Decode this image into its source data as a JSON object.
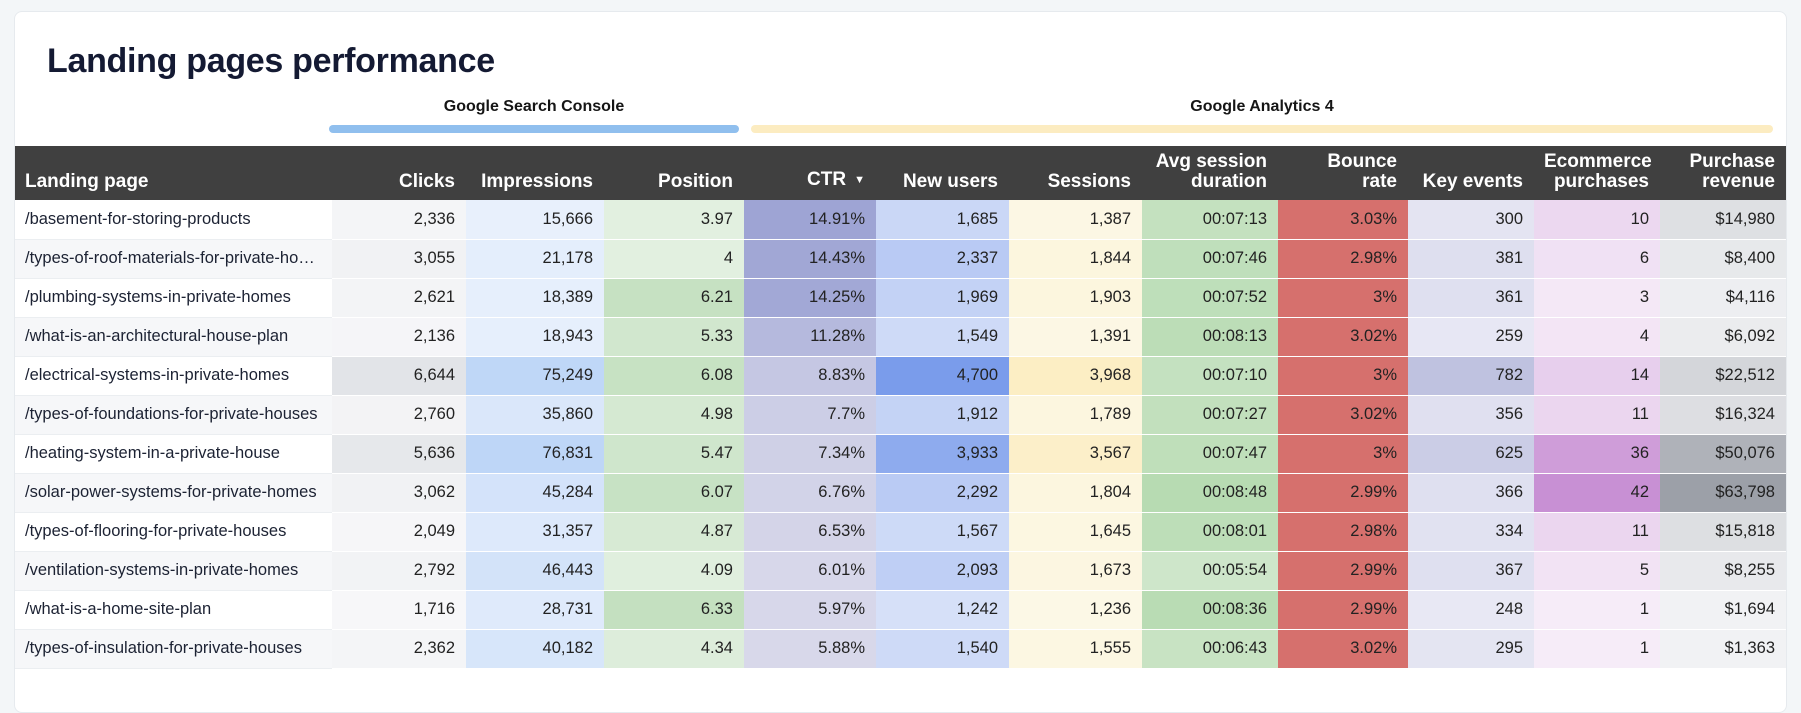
{
  "title": "Landing pages performance",
  "groups": {
    "search_console": "Google Search Console",
    "analytics": "Google Analytics 4"
  },
  "colors": {
    "search_console_bar": "#90bfee",
    "analytics_bar": "#fcecc1",
    "header_bg": "#404040"
  },
  "columns": [
    {
      "key": "page",
      "label": "Landing page"
    },
    {
      "key": "clicks",
      "label": "Clicks"
    },
    {
      "key": "impressions",
      "label": "Impressions"
    },
    {
      "key": "position",
      "label": "Position"
    },
    {
      "key": "ctr",
      "label": "CTR",
      "sorted": "desc"
    },
    {
      "key": "new_users",
      "label": "New users"
    },
    {
      "key": "sessions",
      "label": "Sessions"
    },
    {
      "key": "avg_session_duration",
      "label": "Avg session duration"
    },
    {
      "key": "bounce_rate",
      "label": "Bounce rate"
    },
    {
      "key": "key_events",
      "label": "Key events"
    },
    {
      "key": "ecommerce_purchases",
      "label": "Ecommerce purchases"
    },
    {
      "key": "purchase_revenue",
      "label": "Purchase revenue"
    }
  ],
  "rows": [
    {
      "page": "/basement-for-storing-products",
      "clicks": "2,336",
      "impressions": "15,666",
      "position": "3.97",
      "ctr": "14.91%",
      "new_users": "1,685",
      "sessions": "1,387",
      "avg_session_duration": "00:07:13",
      "bounce_rate": "3.03%",
      "key_events": "300",
      "ecommerce_purchases": "10",
      "purchase_revenue": "$14,980"
    },
    {
      "page": "/types-of-roof-materials-for-private-hou…",
      "clicks": "3,055",
      "impressions": "21,178",
      "position": "4",
      "ctr": "14.43%",
      "new_users": "2,337",
      "sessions": "1,844",
      "avg_session_duration": "00:07:46",
      "bounce_rate": "2.98%",
      "key_events": "381",
      "ecommerce_purchases": "6",
      "purchase_revenue": "$8,400"
    },
    {
      "page": "/plumbing-systems-in-private-homes",
      "clicks": "2,621",
      "impressions": "18,389",
      "position": "6.21",
      "ctr": "14.25%",
      "new_users": "1,969",
      "sessions": "1,903",
      "avg_session_duration": "00:07:52",
      "bounce_rate": "3%",
      "key_events": "361",
      "ecommerce_purchases": "3",
      "purchase_revenue": "$4,116"
    },
    {
      "page": "/what-is-an-architectural-house-plan",
      "clicks": "2,136",
      "impressions": "18,943",
      "position": "5.33",
      "ctr": "11.28%",
      "new_users": "1,549",
      "sessions": "1,391",
      "avg_session_duration": "00:08:13",
      "bounce_rate": "3.02%",
      "key_events": "259",
      "ecommerce_purchases": "4",
      "purchase_revenue": "$6,092"
    },
    {
      "page": "/electrical-systems-in-private-homes",
      "clicks": "6,644",
      "impressions": "75,249",
      "position": "6.08",
      "ctr": "8.83%",
      "new_users": "4,700",
      "sessions": "3,968",
      "avg_session_duration": "00:07:10",
      "bounce_rate": "3%",
      "key_events": "782",
      "ecommerce_purchases": "14",
      "purchase_revenue": "$22,512"
    },
    {
      "page": "/types-of-foundations-for-private-houses",
      "clicks": "2,760",
      "impressions": "35,860",
      "position": "4.98",
      "ctr": "7.7%",
      "new_users": "1,912",
      "sessions": "1,789",
      "avg_session_duration": "00:07:27",
      "bounce_rate": "3.02%",
      "key_events": "356",
      "ecommerce_purchases": "11",
      "purchase_revenue": "$16,324"
    },
    {
      "page": "/heating-system-in-a-private-house",
      "clicks": "5,636",
      "impressions": "76,831",
      "position": "5.47",
      "ctr": "7.34%",
      "new_users": "3,933",
      "sessions": "3,567",
      "avg_session_duration": "00:07:47",
      "bounce_rate": "3%",
      "key_events": "625",
      "ecommerce_purchases": "36",
      "purchase_revenue": "$50,076"
    },
    {
      "page": "/solar-power-systems-for-private-homes",
      "clicks": "3,062",
      "impressions": "45,284",
      "position": "6.07",
      "ctr": "6.76%",
      "new_users": "2,292",
      "sessions": "1,804",
      "avg_session_duration": "00:08:48",
      "bounce_rate": "2.99%",
      "key_events": "366",
      "ecommerce_purchases": "42",
      "purchase_revenue": "$63,798"
    },
    {
      "page": "/types-of-flooring-for-private-houses",
      "clicks": "2,049",
      "impressions": "31,357",
      "position": "4.87",
      "ctr": "6.53%",
      "new_users": "1,567",
      "sessions": "1,645",
      "avg_session_duration": "00:08:01",
      "bounce_rate": "2.98%",
      "key_events": "334",
      "ecommerce_purchases": "11",
      "purchase_revenue": "$15,818"
    },
    {
      "page": "/ventilation-systems-in-private-homes",
      "clicks": "2,792",
      "impressions": "46,443",
      "position": "4.09",
      "ctr": "6.01%",
      "new_users": "2,093",
      "sessions": "1,673",
      "avg_session_duration": "00:05:54",
      "bounce_rate": "2.99%",
      "key_events": "367",
      "ecommerce_purchases": "5",
      "purchase_revenue": "$8,255"
    },
    {
      "page": "/what-is-a-home-site-plan",
      "clicks": "1,716",
      "impressions": "28,731",
      "position": "6.33",
      "ctr": "5.97%",
      "new_users": "1,242",
      "sessions": "1,236",
      "avg_session_duration": "00:08:36",
      "bounce_rate": "2.99%",
      "key_events": "248",
      "ecommerce_purchases": "1",
      "purchase_revenue": "$1,694"
    },
    {
      "page": "/types-of-insulation-for-private-houses",
      "clicks": "2,362",
      "impressions": "40,182",
      "position": "4.34",
      "ctr": "5.88%",
      "new_users": "1,540",
      "sessions": "1,555",
      "avg_session_duration": "00:06:43",
      "bounce_rate": "3.02%",
      "key_events": "295",
      "ecommerce_purchases": "1",
      "purchase_revenue": "$1,363"
    }
  ]
}
